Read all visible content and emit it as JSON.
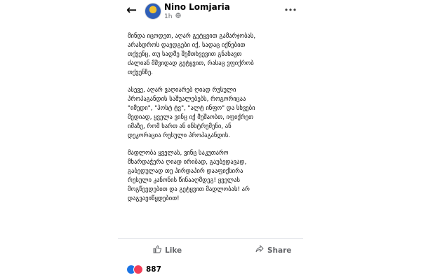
{
  "header": {
    "back_icon": "←",
    "author": "Nino Lomjaria",
    "time": "1h",
    "privacy_icon": "globe-icon",
    "more_icon": "more-icon"
  },
  "post": {
    "paragraphs": [
      "მინდა იცოდეთ, აღარ გეტყვით გამარჯობას,\nარასდროს დავდგები იქ, სადაც იქნებით\nთქვენც, თუ სადმე შემთხვევით გნახავთ\nძალიან მშვიდად გეტყვით, რასაც ვფიქრობ\nთქვენზე.",
      "ასევე, აღარ ვაღიარებ ღიად რუსული\nპროპაგანდის საშუალებებს, როგორიცაა\n\"იმედი\", \"პოსტ ტვ\", \"ალტ ინფო\" და სხვები\nმედიად, ყველა ვინც იქ მუშაობთ, იფიქრეთ\nიმაზე, რომ ხართ ან ინსტრუმენი, ან\nდეკორაცია რუსული პროპაგანდის.",
      "მადლობა ყველას, ვინც საკუთარო\nმხარდაჭერა ღიად ირიბად, გაუბედავად,\nგაბედულად თუ პირდაპირ დააფიქსირა\nრუსული კანონის წინააღმდეგ! ყველას\nმოგწევდებით და  გეტყვით მადლობას! არ\nდაგვავიწყდებით!"
    ]
  },
  "actions": {
    "like_label": "Like",
    "share_label": "Share"
  },
  "reactions": {
    "count": "887",
    "icons": [
      "like-reaction-icon",
      "love-reaction-icon"
    ]
  },
  "colors": {
    "like_blue": "#1b74e4",
    "love_red": "#f33e58",
    "meta_gray": "#65676b"
  }
}
